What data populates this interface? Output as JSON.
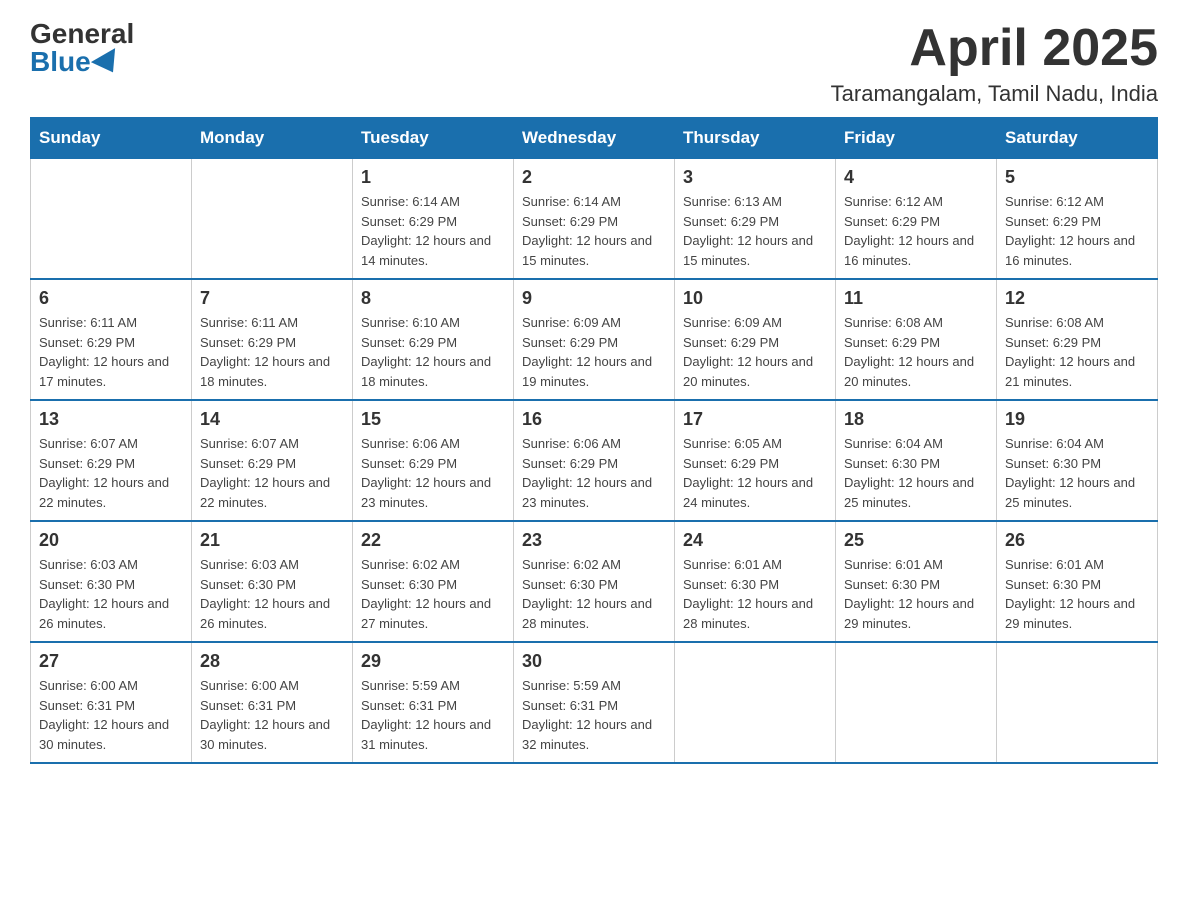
{
  "logo": {
    "general": "General",
    "blue": "Blue"
  },
  "title": "April 2025",
  "subtitle": "Taramangalam, Tamil Nadu, India",
  "headers": [
    "Sunday",
    "Monday",
    "Tuesday",
    "Wednesday",
    "Thursday",
    "Friday",
    "Saturday"
  ],
  "weeks": [
    [
      {
        "day": "",
        "sunrise": "",
        "sunset": "",
        "daylight": ""
      },
      {
        "day": "",
        "sunrise": "",
        "sunset": "",
        "daylight": ""
      },
      {
        "day": "1",
        "sunrise": "Sunrise: 6:14 AM",
        "sunset": "Sunset: 6:29 PM",
        "daylight": "Daylight: 12 hours and 14 minutes."
      },
      {
        "day": "2",
        "sunrise": "Sunrise: 6:14 AM",
        "sunset": "Sunset: 6:29 PM",
        "daylight": "Daylight: 12 hours and 15 minutes."
      },
      {
        "day": "3",
        "sunrise": "Sunrise: 6:13 AM",
        "sunset": "Sunset: 6:29 PM",
        "daylight": "Daylight: 12 hours and 15 minutes."
      },
      {
        "day": "4",
        "sunrise": "Sunrise: 6:12 AM",
        "sunset": "Sunset: 6:29 PM",
        "daylight": "Daylight: 12 hours and 16 minutes."
      },
      {
        "day": "5",
        "sunrise": "Sunrise: 6:12 AM",
        "sunset": "Sunset: 6:29 PM",
        "daylight": "Daylight: 12 hours and 16 minutes."
      }
    ],
    [
      {
        "day": "6",
        "sunrise": "Sunrise: 6:11 AM",
        "sunset": "Sunset: 6:29 PM",
        "daylight": "Daylight: 12 hours and 17 minutes."
      },
      {
        "day": "7",
        "sunrise": "Sunrise: 6:11 AM",
        "sunset": "Sunset: 6:29 PM",
        "daylight": "Daylight: 12 hours and 18 minutes."
      },
      {
        "day": "8",
        "sunrise": "Sunrise: 6:10 AM",
        "sunset": "Sunset: 6:29 PM",
        "daylight": "Daylight: 12 hours and 18 minutes."
      },
      {
        "day": "9",
        "sunrise": "Sunrise: 6:09 AM",
        "sunset": "Sunset: 6:29 PM",
        "daylight": "Daylight: 12 hours and 19 minutes."
      },
      {
        "day": "10",
        "sunrise": "Sunrise: 6:09 AM",
        "sunset": "Sunset: 6:29 PM",
        "daylight": "Daylight: 12 hours and 20 minutes."
      },
      {
        "day": "11",
        "sunrise": "Sunrise: 6:08 AM",
        "sunset": "Sunset: 6:29 PM",
        "daylight": "Daylight: 12 hours and 20 minutes."
      },
      {
        "day": "12",
        "sunrise": "Sunrise: 6:08 AM",
        "sunset": "Sunset: 6:29 PM",
        "daylight": "Daylight: 12 hours and 21 minutes."
      }
    ],
    [
      {
        "day": "13",
        "sunrise": "Sunrise: 6:07 AM",
        "sunset": "Sunset: 6:29 PM",
        "daylight": "Daylight: 12 hours and 22 minutes."
      },
      {
        "day": "14",
        "sunrise": "Sunrise: 6:07 AM",
        "sunset": "Sunset: 6:29 PM",
        "daylight": "Daylight: 12 hours and 22 minutes."
      },
      {
        "day": "15",
        "sunrise": "Sunrise: 6:06 AM",
        "sunset": "Sunset: 6:29 PM",
        "daylight": "Daylight: 12 hours and 23 minutes."
      },
      {
        "day": "16",
        "sunrise": "Sunrise: 6:06 AM",
        "sunset": "Sunset: 6:29 PM",
        "daylight": "Daylight: 12 hours and 23 minutes."
      },
      {
        "day": "17",
        "sunrise": "Sunrise: 6:05 AM",
        "sunset": "Sunset: 6:29 PM",
        "daylight": "Daylight: 12 hours and 24 minutes."
      },
      {
        "day": "18",
        "sunrise": "Sunrise: 6:04 AM",
        "sunset": "Sunset: 6:30 PM",
        "daylight": "Daylight: 12 hours and 25 minutes."
      },
      {
        "day": "19",
        "sunrise": "Sunrise: 6:04 AM",
        "sunset": "Sunset: 6:30 PM",
        "daylight": "Daylight: 12 hours and 25 minutes."
      }
    ],
    [
      {
        "day": "20",
        "sunrise": "Sunrise: 6:03 AM",
        "sunset": "Sunset: 6:30 PM",
        "daylight": "Daylight: 12 hours and 26 minutes."
      },
      {
        "day": "21",
        "sunrise": "Sunrise: 6:03 AM",
        "sunset": "Sunset: 6:30 PM",
        "daylight": "Daylight: 12 hours and 26 minutes."
      },
      {
        "day": "22",
        "sunrise": "Sunrise: 6:02 AM",
        "sunset": "Sunset: 6:30 PM",
        "daylight": "Daylight: 12 hours and 27 minutes."
      },
      {
        "day": "23",
        "sunrise": "Sunrise: 6:02 AM",
        "sunset": "Sunset: 6:30 PM",
        "daylight": "Daylight: 12 hours and 28 minutes."
      },
      {
        "day": "24",
        "sunrise": "Sunrise: 6:01 AM",
        "sunset": "Sunset: 6:30 PM",
        "daylight": "Daylight: 12 hours and 28 minutes."
      },
      {
        "day": "25",
        "sunrise": "Sunrise: 6:01 AM",
        "sunset": "Sunset: 6:30 PM",
        "daylight": "Daylight: 12 hours and 29 minutes."
      },
      {
        "day": "26",
        "sunrise": "Sunrise: 6:01 AM",
        "sunset": "Sunset: 6:30 PM",
        "daylight": "Daylight: 12 hours and 29 minutes."
      }
    ],
    [
      {
        "day": "27",
        "sunrise": "Sunrise: 6:00 AM",
        "sunset": "Sunset: 6:31 PM",
        "daylight": "Daylight: 12 hours and 30 minutes."
      },
      {
        "day": "28",
        "sunrise": "Sunrise: 6:00 AM",
        "sunset": "Sunset: 6:31 PM",
        "daylight": "Daylight: 12 hours and 30 minutes."
      },
      {
        "day": "29",
        "sunrise": "Sunrise: 5:59 AM",
        "sunset": "Sunset: 6:31 PM",
        "daylight": "Daylight: 12 hours and 31 minutes."
      },
      {
        "day": "30",
        "sunrise": "Sunrise: 5:59 AM",
        "sunset": "Sunset: 6:31 PM",
        "daylight": "Daylight: 12 hours and 32 minutes."
      },
      {
        "day": "",
        "sunrise": "",
        "sunset": "",
        "daylight": ""
      },
      {
        "day": "",
        "sunrise": "",
        "sunset": "",
        "daylight": ""
      },
      {
        "day": "",
        "sunrise": "",
        "sunset": "",
        "daylight": ""
      }
    ]
  ]
}
